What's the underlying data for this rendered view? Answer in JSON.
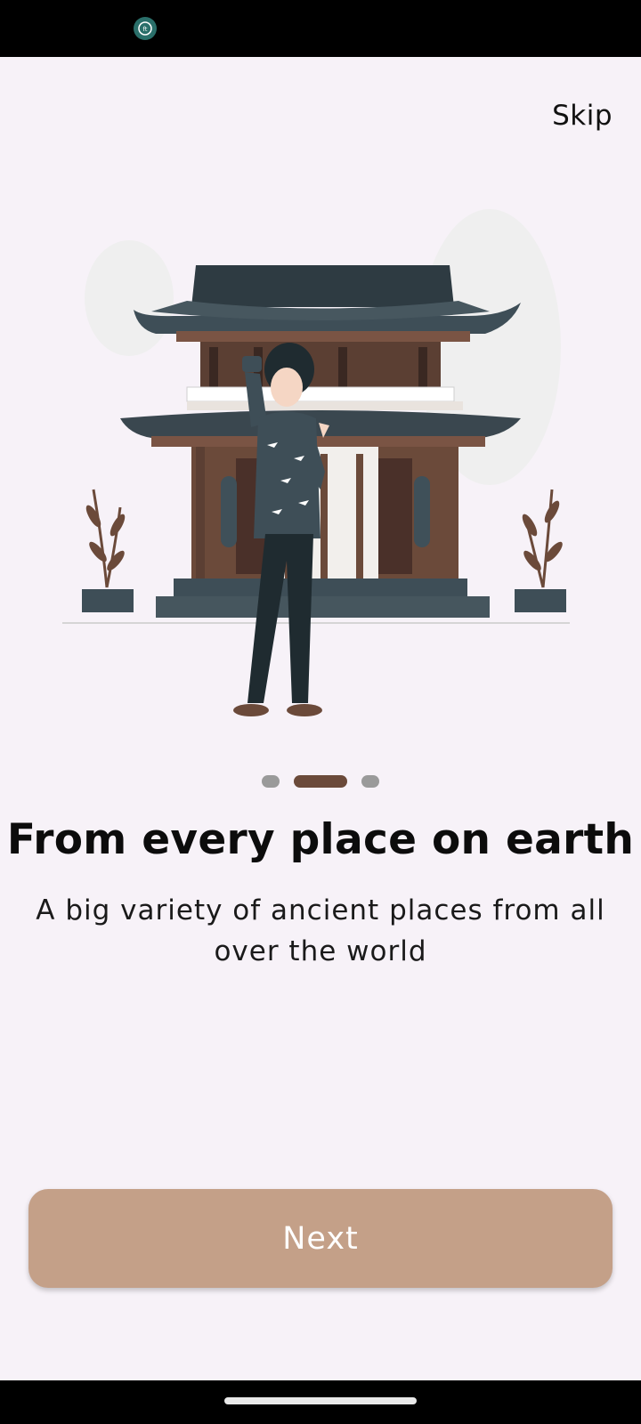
{
  "status_bar": {
    "app_icon": "ft-app-icon",
    "app_icon_text": "ft"
  },
  "header": {
    "skip_label": "Skip"
  },
  "illustration": {
    "subject": "traveler-taking-selfie-at-temple-illustration"
  },
  "pager": {
    "total": 3,
    "active_index": 1
  },
  "content": {
    "title": "From every place on earth",
    "subtitle": "A big variety of ancient places from all over the world"
  },
  "actions": {
    "next_label": "Next"
  },
  "colors": {
    "background": "#f7f2f8",
    "accent_button": "#c4a088",
    "active_dot": "#6b4a3a",
    "inactive_dot": "#9a9a9a"
  }
}
